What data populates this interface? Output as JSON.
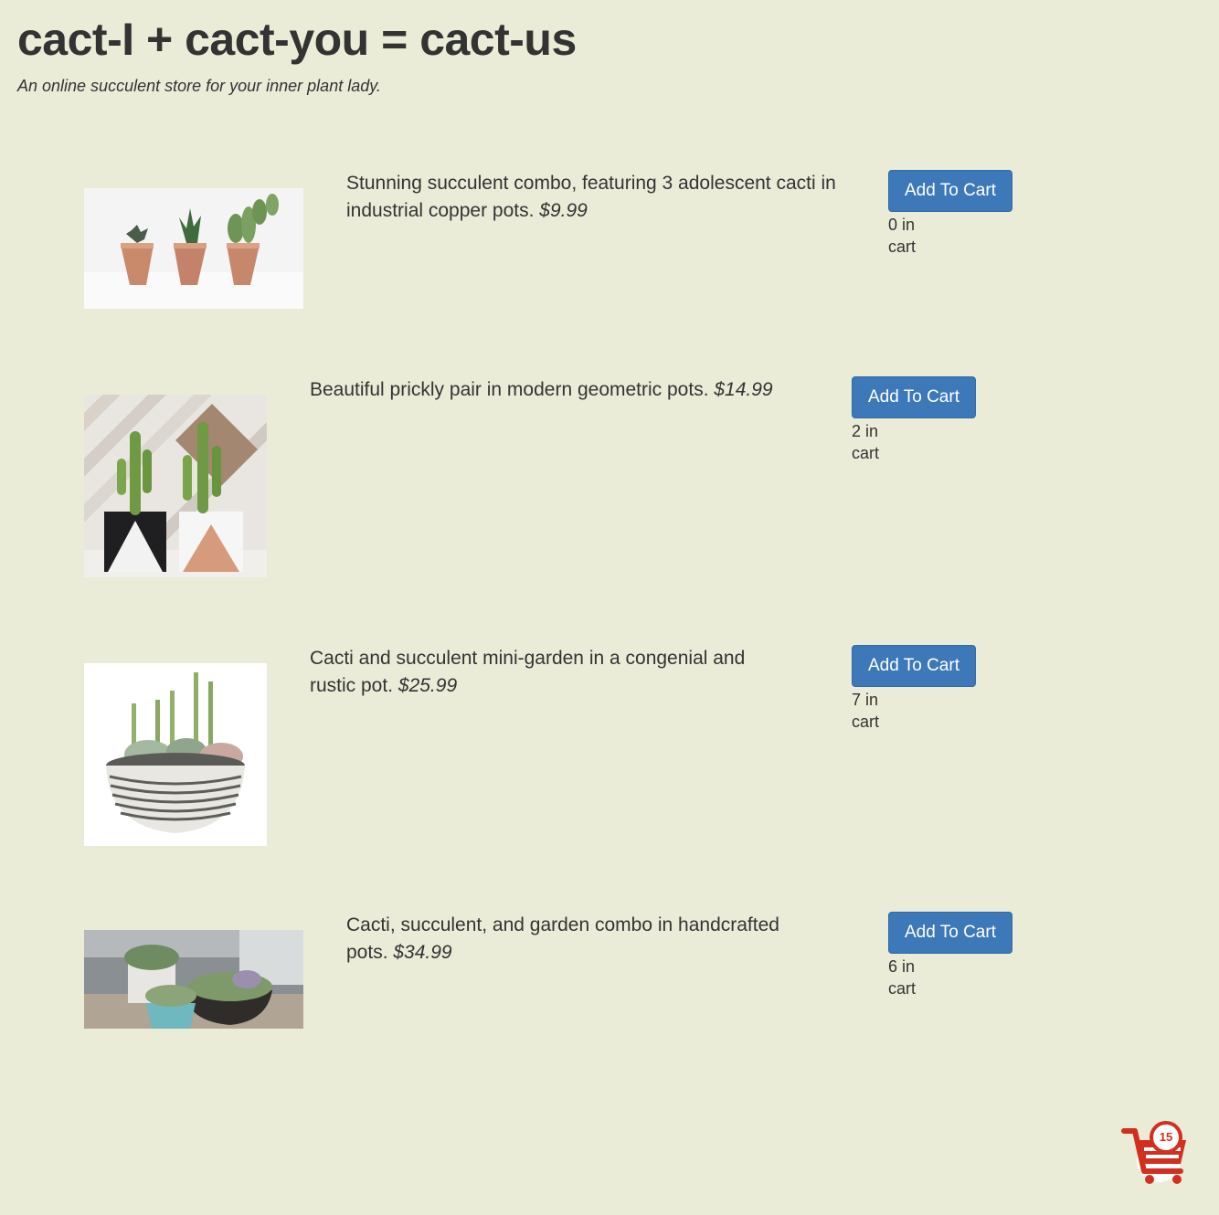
{
  "header": {
    "title": "cact-I + cact-you = cact-us",
    "tagline": "An online succulent store for your inner plant lady."
  },
  "products": [
    {
      "description": "Stunning succulent combo, featuring 3 adolescent cacti in industrial copper pots.",
      "price": "$9.99",
      "button_label": "Add To Cart",
      "in_cart": "0 in cart",
      "image": "three cacti in copper pots"
    },
    {
      "description": "Beautiful prickly pair in modern geometric pots.",
      "price": "$14.99",
      "button_label": "Add To Cart",
      "in_cart": "2 in cart",
      "image": "two cacti in geometric pots"
    },
    {
      "description": "Cacti and succulent mini-garden in a congenial and rustic pot.",
      "price": "$25.99",
      "button_label": "Add To Cart",
      "in_cart": "7 in cart",
      "image": "succulent mini-garden in striped bowl"
    },
    {
      "description": "Cacti, succulent, and garden combo in handcrafted pots.",
      "price": "$34.99",
      "button_label": "Add To Cart",
      "in_cart": "6 in cart",
      "image": "succulent garden combo in handcrafted pots"
    }
  ],
  "cart": {
    "count": "15",
    "icon": "shopping-cart-icon"
  },
  "colors": {
    "background": "#ebecd8",
    "button": "#3d79b8",
    "cart_red": "#d32f1f",
    "text": "#333333"
  }
}
